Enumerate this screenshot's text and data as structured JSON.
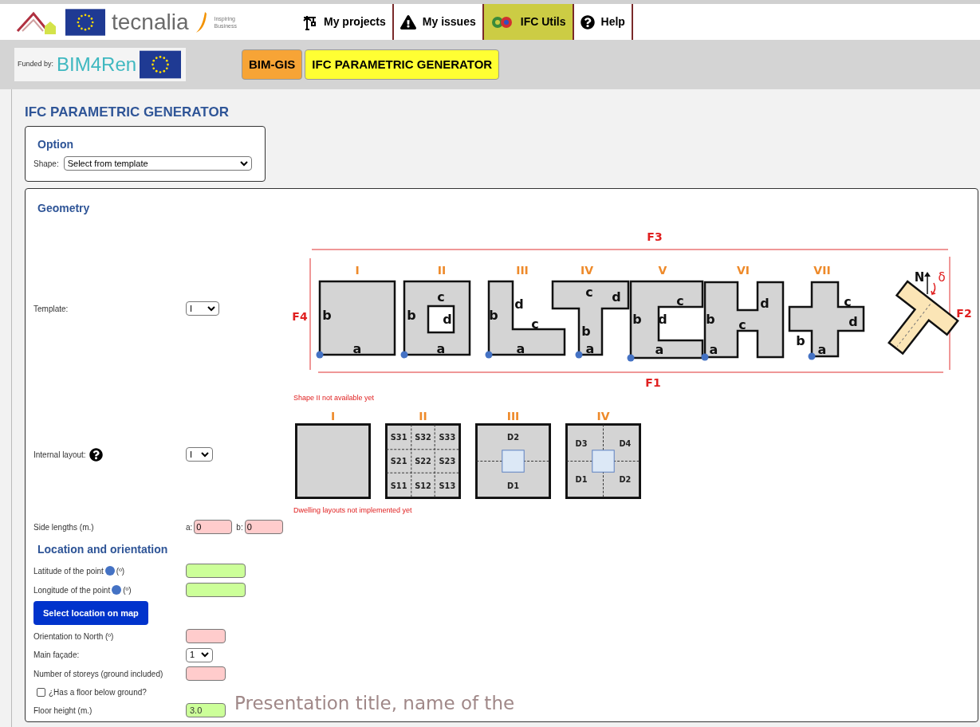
{
  "header": {
    "logo_text": "tecnalia",
    "tagline": [
      "Inspiring",
      "Business"
    ],
    "nav": [
      {
        "label": "My projects",
        "selected": false
      },
      {
        "label": "My issues",
        "selected": false
      },
      {
        "label": "IFC Utils",
        "selected": true
      },
      {
        "label": "Help",
        "selected": false
      }
    ]
  },
  "funding": {
    "label": "Funded by:",
    "logo_text": "BIM4Ren"
  },
  "subnav": [
    {
      "label": "BIM-GIS",
      "color": "#f7a436"
    },
    {
      "label": "IFC PARAMETRIC GENERATOR",
      "color": "#ffff33"
    }
  ],
  "page_title": "IFC PARAMETRIC GENERATOR",
  "option": {
    "title": "Option",
    "shape_label": "Shape:",
    "shape_value": "Select from template"
  },
  "geometry": {
    "title": "Geometry",
    "template_label": "Template:",
    "template_value": "I",
    "diagram": {
      "facades": {
        "top": "F3",
        "left": "F4",
        "bottom": "F1",
        "right": "F2"
      },
      "shapes": [
        {
          "numeral": "I",
          "sides": [
            "b",
            "a"
          ]
        },
        {
          "numeral": "II",
          "sides": [
            "b",
            "c",
            "d",
            "a"
          ]
        },
        {
          "numeral": "III",
          "sides": [
            "b",
            "d",
            "c",
            "a"
          ]
        },
        {
          "numeral": "IV",
          "sides": [
            "c",
            "d",
            "b",
            "a"
          ]
        },
        {
          "numeral": "V",
          "sides": [
            "c",
            "b",
            "d",
            "a"
          ]
        },
        {
          "numeral": "VI",
          "sides": [
            "b",
            "c",
            "d",
            "a"
          ]
        },
        {
          "numeral": "VII",
          "sides": [
            "c",
            "d",
            "b",
            "a"
          ]
        }
      ],
      "north": "N",
      "angle": "δ"
    },
    "shape_note": "Shape II not available yet",
    "internal_layout_label": "Internal layout:",
    "internal_layout_value": "I",
    "layouts": [
      {
        "numeral": "I",
        "kind": "empty"
      },
      {
        "numeral": "II",
        "kind": "grid",
        "cells": [
          "S31",
          "S32",
          "S33",
          "S21",
          "S22",
          "S23",
          "S11",
          "S12",
          "S13"
        ]
      },
      {
        "numeral": "III",
        "kind": "two",
        "cells": [
          "D2",
          "D1"
        ]
      },
      {
        "numeral": "IV",
        "kind": "four",
        "cells": [
          "D3",
          "D4",
          "D1",
          "D2"
        ]
      }
    ],
    "layout_note": "Dwelling layouts not implemented yet",
    "side_lengths": {
      "label": "Side lengths (m.)",
      "a_label": "a:",
      "a_value": "0",
      "b_label": "b:",
      "b_value": "0",
      "color": "#ffcccc"
    }
  },
  "location": {
    "title": "Location and orientation",
    "rows": [
      {
        "kind": "input",
        "label": "Latitude of the point",
        "suffix": "(º)",
        "dot": true,
        "color": "#ccff99"
      },
      {
        "kind": "input",
        "label": "Longitude of the point",
        "suffix": "(º)",
        "dot": true,
        "color": "#ccff99"
      },
      {
        "kind": "button",
        "label": "Select location on map"
      },
      {
        "kind": "input",
        "label": "Orientation to North (º)",
        "color": "#ffcccc"
      },
      {
        "kind": "select",
        "label": "Main façade:",
        "value": "1"
      },
      {
        "kind": "input",
        "label": "Number of storeys (ground included)",
        "color": "#ffcccc"
      },
      {
        "kind": "checkbox",
        "label": "¿Has a floor below ground?",
        "checked": false
      },
      {
        "kind": "input",
        "label": "Floor height (m.)",
        "value": "3.0",
        "color": "#ccff99"
      }
    ]
  },
  "overlay_text": "Presentation title, name of the"
}
